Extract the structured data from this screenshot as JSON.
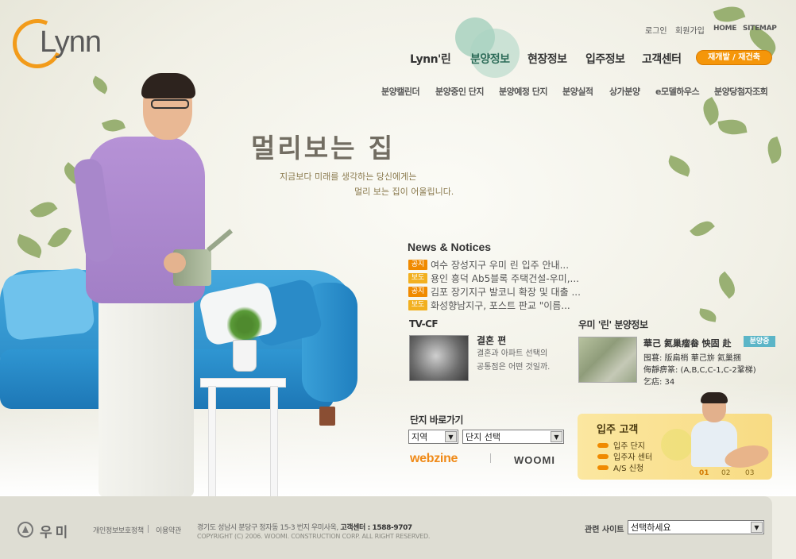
{
  "header": {
    "logo_text": "Lynn",
    "utility": [
      "로그인",
      "회원가입",
      "HOME",
      "SITEMAP"
    ],
    "gnb": [
      "Lynn'린",
      "분양정보",
      "현장정보",
      "입주정보",
      "고객센터"
    ],
    "rebuild_label": "재개발 / 재건축",
    "sub_menu": [
      "분양캘린더",
      "분양중인 단지",
      "분양예정 단지",
      "분양실적",
      "상가분양",
      "e모델하우스",
      "분양당첨자조회"
    ]
  },
  "hero": {
    "headline": "멀리보는 집",
    "line1": "지금보다 미래를 생각하는 당신에게는",
    "line2": "멀리 보는 집이 어울립니다."
  },
  "news": {
    "title": "News & Notices",
    "items": [
      {
        "tag": "공지",
        "text": "여수 장성지구 우미 린 입주 안내..."
      },
      {
        "tag": "보도",
        "text": "용인 흥덕 Ab5블록 주택건설-우미,..."
      },
      {
        "tag": "공지",
        "text": "김포 장기지구 발코니 확장 및 대출 ..."
      },
      {
        "tag": "보도",
        "text": "화성향남지구, 포스트 판교 \"이름..."
      }
    ]
  },
  "tvcf": {
    "title": "TV-CF",
    "headline": "결혼 편",
    "desc1": "결혼과 아파트 선택의",
    "desc2": "공통점은 어떤 것일까."
  },
  "sale": {
    "title": "우미 '린' 분양정보",
    "line1": "華己 氦巢瘤畚 怏固 赴",
    "badge": "분양중",
    "line2": "囤葚: 版扁梢 華己旂 氦巢捆",
    "line3": "侮靜痹篆: (A,B,C,C-1,C-2鞏梯)",
    "line4": "乞痁: 34"
  },
  "shortcut": {
    "title": "단지 바로가기",
    "region_value": "지역",
    "complex_value": "단지 선택",
    "webzine_label": "webzine",
    "woomi_label": "WOOMI"
  },
  "resident": {
    "title": "입주 고객",
    "items": [
      "입주 단지",
      "입주자 센터",
      "A/S 신청"
    ],
    "pages": [
      "01",
      "02",
      "03"
    ]
  },
  "footer": {
    "logo_text": "우미",
    "links": [
      "개인정보보호정책",
      "이용약관"
    ],
    "address": "경기도 성남시 분당구 정자동 15-3 번지 우미사옥,",
    "center_label": "고객센터 : 1588-9707",
    "copyright": "COPYRIGHT (C) 2006. WOOMI. CONSTRUCTION CORP. ALL RIGHT RESERVED.",
    "related_label": "관련 사이트",
    "related_value": "선택하세요"
  },
  "colors": {
    "accent": "#f29b1a",
    "gnb_active": "#2c6b58",
    "tag_notice": "#f08a00",
    "tag_press": "#f2b020"
  }
}
